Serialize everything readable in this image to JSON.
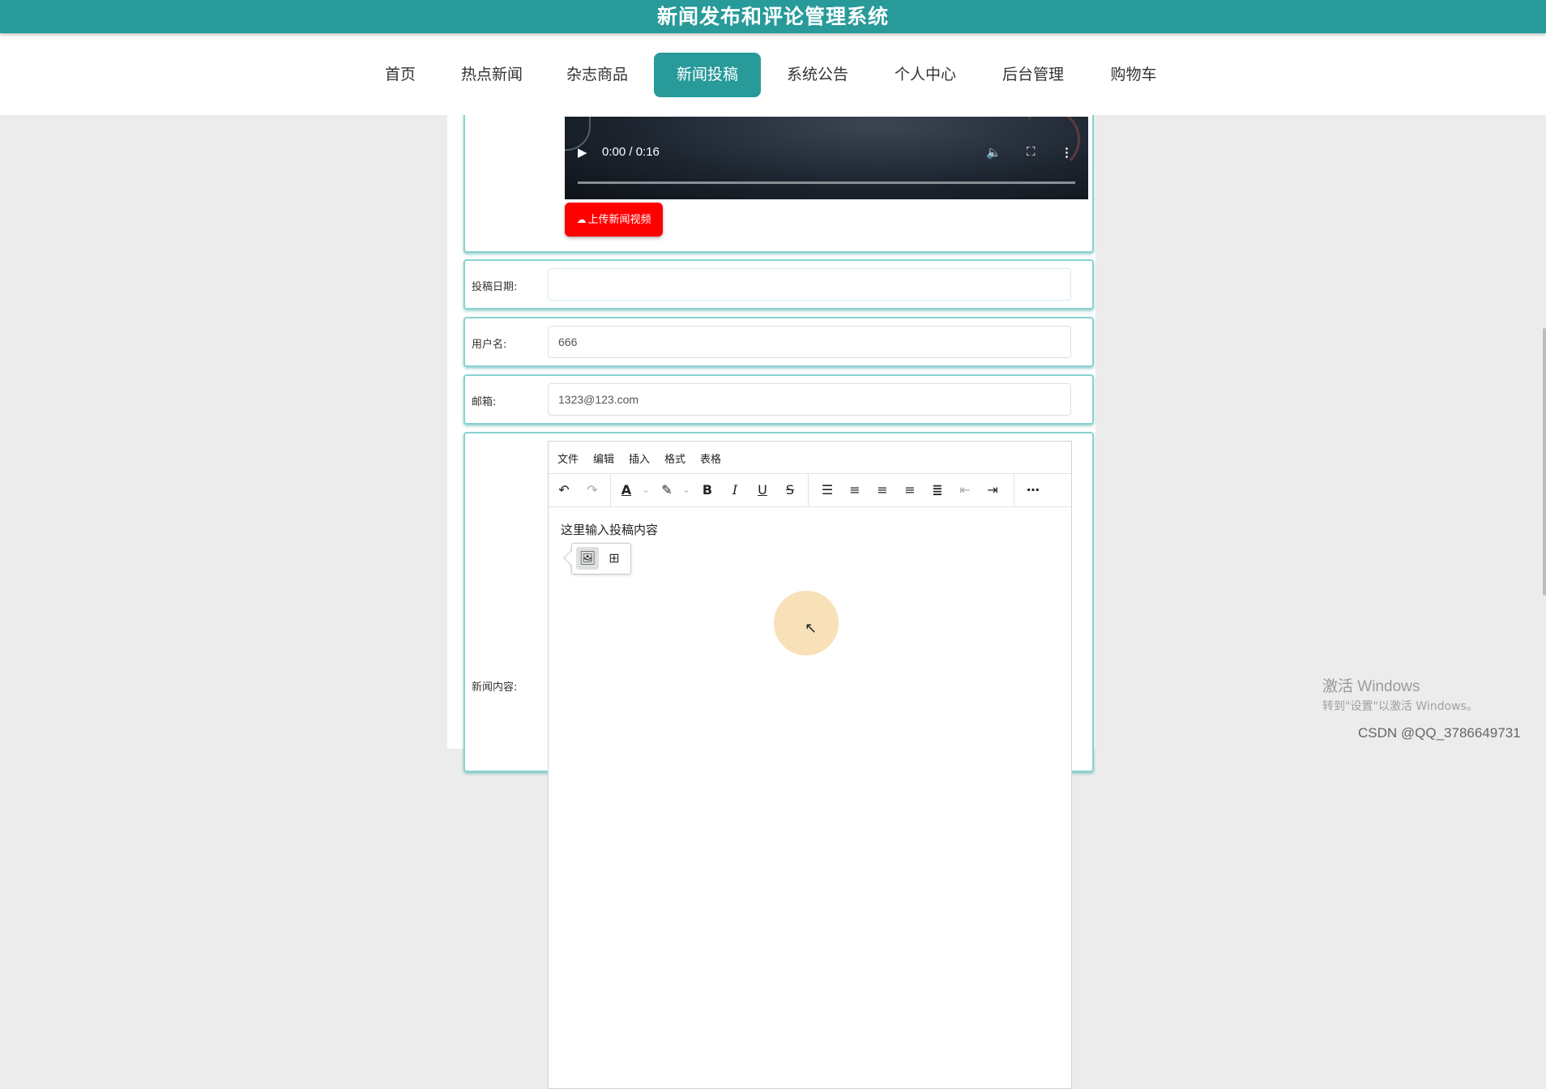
{
  "header": {
    "title": "新闻发布和评论管理系统"
  },
  "nav": {
    "items": [
      {
        "label": "首页"
      },
      {
        "label": "热点新闻"
      },
      {
        "label": "杂志商品"
      },
      {
        "label": "新闻投稿",
        "active": true
      },
      {
        "label": "系统公告"
      },
      {
        "label": "个人中心"
      },
      {
        "label": "后台管理"
      },
      {
        "label": "购物车"
      }
    ]
  },
  "video": {
    "time": "0:00 / 0:16",
    "upload_label": "上传新闻视频"
  },
  "form": {
    "date_label": "投稿日期:",
    "date_value": "",
    "username_label": "用户名:",
    "username_value": "666",
    "email_label": "邮箱:",
    "email_value": "1323@123.com",
    "content_label": "新闻内容:"
  },
  "editor": {
    "menu": [
      "文件",
      "编辑",
      "插入",
      "格式",
      "表格"
    ],
    "placeholder_text": "这里输入投稿内容",
    "toolbar_icons": [
      "undo-icon",
      "redo-icon",
      "font-color-icon",
      "highlight-icon",
      "bold-icon",
      "italic-icon",
      "underline-icon",
      "strikethrough-icon",
      "line-height-icon",
      "align-left-icon",
      "align-center-icon",
      "align-right-icon",
      "justify-icon",
      "outdent-icon",
      "indent-icon",
      "more-icon"
    ]
  },
  "watermark": {
    "line1": "激活 Windows",
    "line2": "转到\"设置\"以激活 Windows。",
    "csdn": "CSDN @QQ_3786649731"
  },
  "colors": {
    "primary": "#279a99",
    "upload": "#ff0000",
    "card_border": "#88d2d1"
  }
}
